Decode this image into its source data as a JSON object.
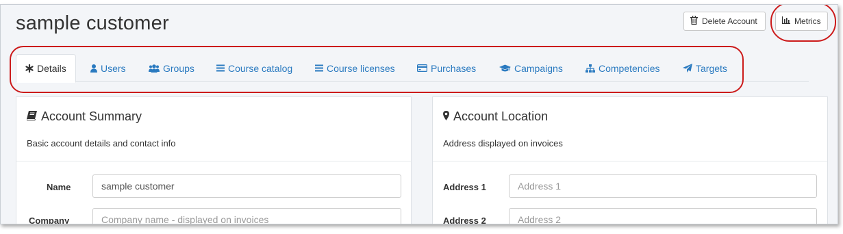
{
  "header": {
    "title": "sample customer",
    "delete_label": "Delete Account",
    "metrics_label": "Metrics"
  },
  "tabs": [
    {
      "label": "Details",
      "icon": "asterisk-icon",
      "active": true
    },
    {
      "label": "Users",
      "icon": "user-icon"
    },
    {
      "label": "Groups",
      "icon": "users-icon"
    },
    {
      "label": "Course catalog",
      "icon": "list-icon"
    },
    {
      "label": "Course licenses",
      "icon": "list-icon"
    },
    {
      "label": "Purchases",
      "icon": "credit-card-icon"
    },
    {
      "label": "Campaigns",
      "icon": "graduation-cap-icon"
    },
    {
      "label": "Competencies",
      "icon": "sitemap-icon"
    },
    {
      "label": "Targets",
      "icon": "paper-plane-icon"
    }
  ],
  "summary": {
    "title": "Account Summary",
    "subtitle": "Basic account details and contact info",
    "fields": [
      {
        "label": "Name",
        "value": "sample customer",
        "placeholder": ""
      },
      {
        "label": "Company",
        "value": "",
        "placeholder": "Company name - displayed on invoices"
      }
    ]
  },
  "location": {
    "title": "Account Location",
    "subtitle": "Address displayed on invoices",
    "fields": [
      {
        "label": "Address 1",
        "value": "",
        "placeholder": "Address 1"
      },
      {
        "label": "Address 2",
        "value": "",
        "placeholder": "Address 2"
      }
    ]
  },
  "colors": {
    "link": "#2a7ac0",
    "annotation": "#cc1b1b"
  }
}
